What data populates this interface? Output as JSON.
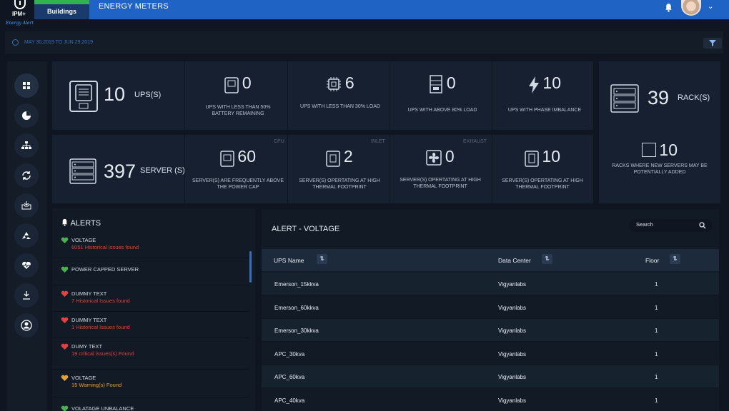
{
  "app": {
    "logo_text": "IPM+",
    "logo_subtext": "Energy Alert",
    "tab_label": "Buildings",
    "page_title": "ENERGY METERS"
  },
  "datebar": {
    "range": "MAY 30,2019 TO JUN 29,2019"
  },
  "nav": [
    "dashboard-icon",
    "pie-chart-icon",
    "hierarchy-icon",
    "sync-icon",
    "inbox-icon",
    "recycle-icon",
    "heartbeat-icon",
    "download-icon",
    "user-icon"
  ],
  "summary": {
    "ups": {
      "count": "10",
      "unit": "UPS(S)"
    },
    "ups_battery": {
      "value": "0",
      "caption": "UPS WITH LESS THAN 50% BATTERY REMAINING"
    },
    "ups_load30": {
      "value": "6",
      "caption": "UPS WITH LESS THAN 30% LOAD"
    },
    "ups_load80": {
      "value": "0",
      "caption": "UPS WITH ABOVE 80% LOAD"
    },
    "ups_phase": {
      "value": "10",
      "caption": "UPS WITH PHASE IMBALANCE"
    },
    "server": {
      "count": "397",
      "unit": "SERVER (S)"
    },
    "server_cpu": {
      "tag": "CPU",
      "value": "60",
      "caption": "SERVER(S) ARE FREQUENTLY ABOVE THE POWER CAP"
    },
    "server_inlet": {
      "tag": "INLET",
      "value": "2",
      "caption": "SERVER(S) OPERTATING AT HIGH THERMAL FOOTPRINT"
    },
    "server_exhaust": {
      "tag": "EXHAUST",
      "value": "0",
      "caption": "SERVER(S) OPERTATING AT HIGH THERMAL FOOTPRINT"
    },
    "server_other": {
      "value": "10",
      "caption": "SERVER(S) OPERTATING AT HIGH THERMAL FOOTPRINT"
    },
    "rack": {
      "count": "39",
      "unit": "RACK(S)"
    },
    "rack_new": {
      "value": "10",
      "caption": "RACKS WHERE NEW SERVERS MAY BE POTENTIALLY ADDED"
    }
  },
  "alerts": {
    "title": "ALERTS",
    "items": [
      {
        "title": "VOLTAGE",
        "sub": "6051 Historical Issues found",
        "color": "#4caf50",
        "subcolor": "#e0443e"
      },
      {
        "title": "POWER CAPPED SERVER",
        "sub": "",
        "color": "#4caf50",
        "subcolor": "#e0443e"
      },
      {
        "title": "DUMMY TEXT",
        "sub": "7 Historical Issues found",
        "color": "#e0443e",
        "subcolor": "#e0443e"
      },
      {
        "title": "DUMMY TEXT",
        "sub": "1 Historical Issues found",
        "color": "#e0443e",
        "subcolor": "#e0443e"
      },
      {
        "title": "DUMY TEXT",
        "sub": "19 critical issues(s) Found",
        "color": "#e0443e",
        "subcolor": "#e0443e"
      },
      {
        "title": "VOLTAGE",
        "sub": "15 Warning(s) Found",
        "color": "#e0a23e",
        "subcolor": "#e0a23e"
      },
      {
        "title": "VOLATAGE UNBALANCE",
        "sub": "",
        "color": "#4caf50",
        "subcolor": "#e0443e"
      }
    ]
  },
  "voltage_table": {
    "title": "ALERT - VOLTAGE",
    "search_placeholder": "Search",
    "columns": [
      "UPS Name",
      "Data Center",
      "Floor"
    ],
    "rows": [
      [
        "Emerson_15kkva",
        "Vigyanlabs",
        "1"
      ],
      [
        "Emerson_60kkva",
        "Vigyanlabs",
        "1"
      ],
      [
        "Emerson_30kkva",
        "Vigyanlabs",
        "1"
      ],
      [
        "APC_30kva",
        "Vigyanlabs",
        "1"
      ],
      [
        "APC_60kva",
        "Vigyanlabs",
        "1"
      ],
      [
        "APC_40kva",
        "Vigyanlabs",
        "1"
      ]
    ]
  }
}
